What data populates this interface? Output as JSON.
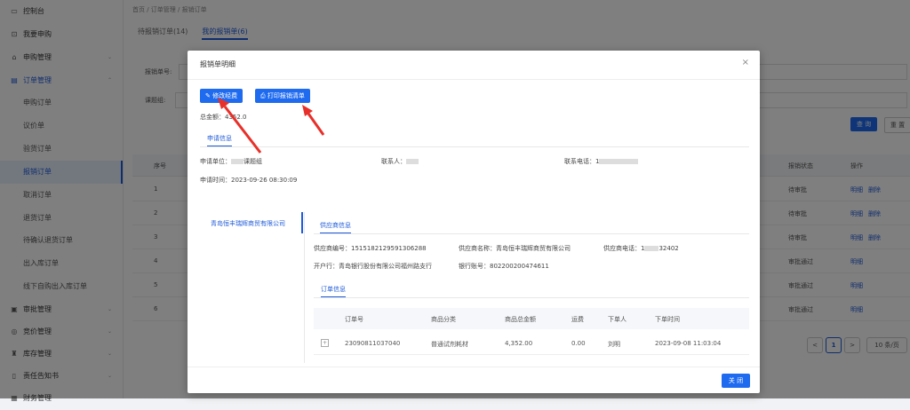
{
  "sidebar": {
    "items": [
      {
        "icon": "monitor-icon",
        "label": "控制台",
        "arrow": ""
      },
      {
        "icon": "cart-icon",
        "label": "我要申购",
        "arrow": ""
      },
      {
        "icon": "bag-icon",
        "label": "申购管理",
        "arrow": "⌄"
      },
      {
        "icon": "doc-icon",
        "label": "订单管理",
        "arrow": "⌃"
      }
    ],
    "subitems": [
      "申购订单",
      "议价单",
      "验货订单",
      "报销订单",
      "取消订单",
      "退货订单",
      "待确认退货订单",
      "出入库订单",
      "线下自购出入库订单"
    ],
    "active_sub": 3,
    "bottom_items": [
      {
        "icon": "audit-icon",
        "label": "审批管理",
        "arrow": "⌄"
      },
      {
        "icon": "bid-icon",
        "label": "竞价管理",
        "arrow": "⌄"
      },
      {
        "icon": "warehouse-icon",
        "label": "库存管理",
        "arrow": "⌄"
      },
      {
        "icon": "notice-icon",
        "label": "责任告知书",
        "arrow": "⌄"
      },
      {
        "icon": "more-icon",
        "label": "财务管理",
        "arrow": "⌄"
      }
    ]
  },
  "breadcrumb": "首页 / 订单管理 / 报销订单",
  "tabs": [
    "待报销订单(14)",
    "我的报销单(6)"
  ],
  "filters": {
    "label1": "报销单号:",
    "label2": "课题组:"
  },
  "buttons": {
    "query": "查 询",
    "reset": "重 置"
  },
  "table": {
    "headers": {
      "seq": "序号",
      "status": "报销状态",
      "op": "操作"
    },
    "rows": [
      {
        "seq": "1",
        "status": "待审批",
        "op1": "明细",
        "op2": "删除"
      },
      {
        "seq": "2",
        "status": "待审批",
        "op1": "明细",
        "op2": "删除"
      },
      {
        "seq": "3",
        "status": "待审批",
        "op1": "明细",
        "op2": "删除"
      },
      {
        "seq": "4",
        "status": "审批通过",
        "op1": "明细",
        "op2": ""
      },
      {
        "seq": "5",
        "status": "审批通过",
        "op1": "明细",
        "op2": ""
      },
      {
        "seq": "6",
        "status": "审批通过",
        "op1": "明细",
        "op2": ""
      }
    ]
  },
  "pager": {
    "prev": "<",
    "page": "1",
    "next": ">",
    "size": "10 条/页"
  },
  "modal": {
    "title": "报销单明细",
    "close_glyph": "×",
    "btn_edit": "修改经费",
    "btn_print": "打印报销清单",
    "total_label": "总金额：",
    "total_value": "4352.0",
    "section_apply": "申请信息",
    "apply_unit_label": "申请单位：",
    "apply_unit_value": "课题组",
    "contact_label": "联系人：",
    "phone_label": "联系电话：",
    "phone_value": "1",
    "apply_time": "申请时间：2023-09-26 08:30:09",
    "supplier_side": "青岛恒丰瑞辉商贸有限公司",
    "section_supplier": "供应商信息",
    "supplier_code": "供应商编号：1515182129591306288",
    "supplier_name": "供应商名称：青岛恒丰瑞辉商贸有限公司",
    "supplier_phone_label": "供应商电话：1",
    "supplier_phone_tail": "32402",
    "bank": "开户行：青岛银行股份有限公司福州路支行",
    "account": "银行账号：802200200474611",
    "section_order": "订单信息",
    "order_headers": [
      "订单号",
      "商品分类",
      "商品总金额",
      "运费",
      "下单人",
      "下单时间"
    ],
    "order_row": [
      "23090811037040",
      "普通试剂耗材",
      "4,352.00",
      "0.00",
      "刘明",
      "2023-09-08 11:03:04"
    ],
    "expand_glyph": "+",
    "btn_close": "关 闭"
  },
  "colors": {
    "accent": "#1f6bf0",
    "arrow": "#e8302a"
  }
}
